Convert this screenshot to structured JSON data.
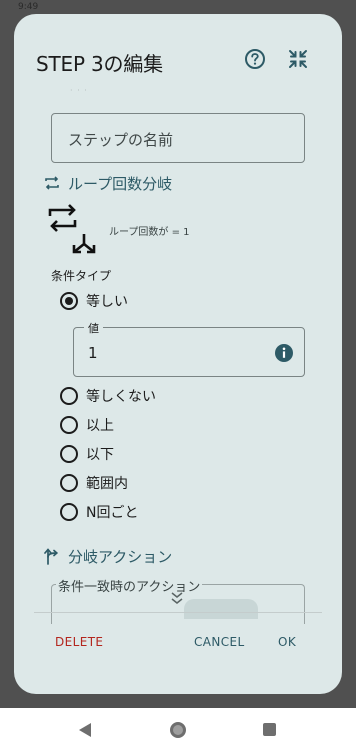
{
  "status_bar": {
    "left_text": "9:49",
    "right_text": ""
  },
  "dialog": {
    "title": "STEP 3の編集",
    "help_icon": "help-circle-icon",
    "collapse_icon": "collapse-icon",
    "faded_text": "· · ·",
    "step_name_placeholder": "ステップの名前",
    "loop_section": {
      "icon": "repeat-icon",
      "label": "ループ回数分岐"
    },
    "loop_caption": "ループ回数が = 1",
    "condition_type_label": "条件タイプ",
    "radios": [
      {
        "label": "等しい",
        "selected": true
      },
      {
        "label": "等しくない",
        "selected": false
      },
      {
        "label": "以上",
        "selected": false
      },
      {
        "label": "以下",
        "selected": false
      },
      {
        "label": "範囲内",
        "selected": false
      },
      {
        "label": "N回ごと",
        "selected": false
      }
    ],
    "value_field": {
      "label": "値",
      "value": "1",
      "info_icon": "info-icon"
    },
    "branch_section": {
      "icon": "branch-arrow-icon",
      "label": "分岐アクション"
    },
    "match_action_label": "条件一致時のアクション",
    "buttons": {
      "delete": "DELETE",
      "cancel": "CANCEL",
      "ok": "OK"
    }
  },
  "nav_bar": {
    "back": "back-icon",
    "home": "home-icon",
    "recents": "recents-icon"
  },
  "colors": {
    "accent": "#2d5a66",
    "danger": "#b3261e",
    "dialog_bg": "#dde8e8",
    "scrim": "#505050"
  }
}
